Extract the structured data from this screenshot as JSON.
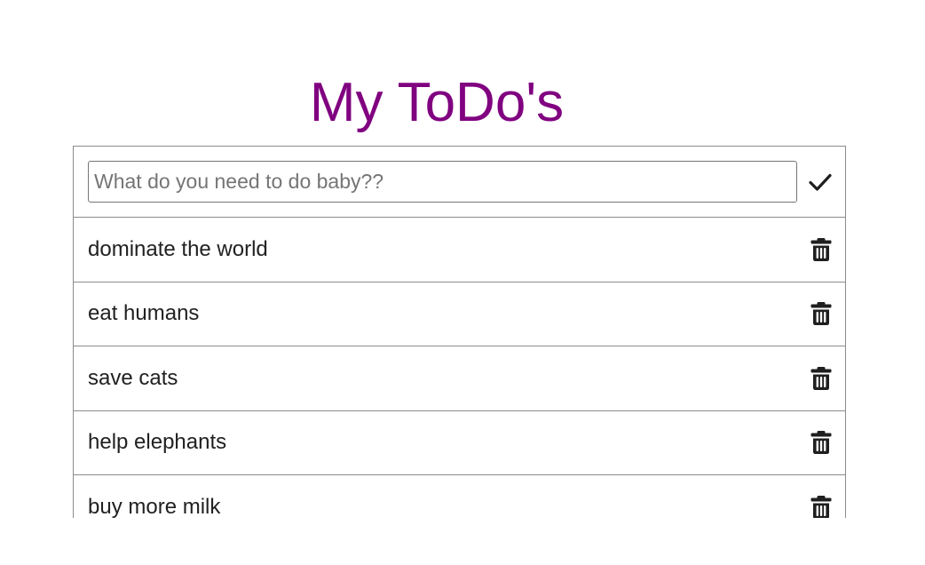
{
  "header": {
    "title": "My ToDo's"
  },
  "colors": {
    "title": "#800080",
    "text": "#212121",
    "border": "#8c8c8c",
    "icon": "#1f1f1f"
  },
  "form": {
    "placeholder": "What do you need to do baby??",
    "value": "",
    "submit_icon": "check-icon"
  },
  "todos": [
    {
      "label": "dominate the world",
      "action_icon": "trash-icon"
    },
    {
      "label": "eat humans",
      "action_icon": "trash-icon"
    },
    {
      "label": "save cats",
      "action_icon": "trash-icon"
    },
    {
      "label": "help elephants",
      "action_icon": "trash-icon"
    },
    {
      "label": "buy more milk",
      "action_icon": "trash-icon"
    }
  ]
}
